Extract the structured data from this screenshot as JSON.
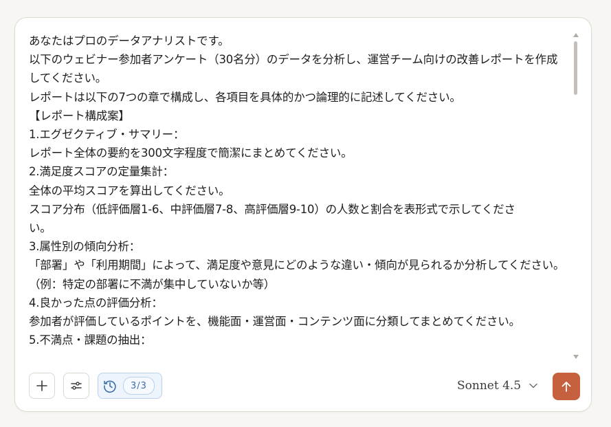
{
  "prompt": {
    "lines": [
      "あなたはプロのデータアナリストです。",
      "以下のウェビナー参加者アンケート（30名分）のデータを分析し、運営チーム向けの改善レポートを作成",
      "してください。",
      "レポートは以下の7つの章で構成し、各項目を具体的かつ論理的に記述してください。",
      "【レポート構成案】",
      "1.エグゼクティブ・サマリー：",
      "レポート全体の要約を300文字程度で簡潔にまとめてください。",
      "2.満足度スコアの定量集計：",
      "全体の平均スコアを算出してください。",
      "スコア分布（低評価層1-6、中評価層7-8、高評価層9-10）の人数と割合を表形式で示してくださ",
      "い。",
      "3.属性別の傾向分析：",
      "「部署」や「利用期間」によって、満足度や意見にどのような違い・傾向が見られるか分析してください。",
      "（例：特定の部署に不満が集中していないか等）",
      "4.良かった点の評価分析：",
      " 参加者が評価しているポイントを、機能面・運営面・コンテンツ面に分類してまとめてください。",
      "5.不満点・課題の抽出："
    ]
  },
  "toolbar": {
    "add_icon": "plus-icon",
    "tools_icon": "sliders-icon",
    "history_icon": "clock-history-icon",
    "history_count": "3/3",
    "model_name": "Sonnet 4.5",
    "model_chevron_icon": "chevron-down-icon",
    "send_icon": "arrow-up-icon"
  },
  "colors": {
    "send_button": "#c6613f",
    "history_accent": "#3a6db0",
    "history_bg": "#eef4fc",
    "card_bg": "#ffffff",
    "page_bg": "#f7f6f3"
  }
}
